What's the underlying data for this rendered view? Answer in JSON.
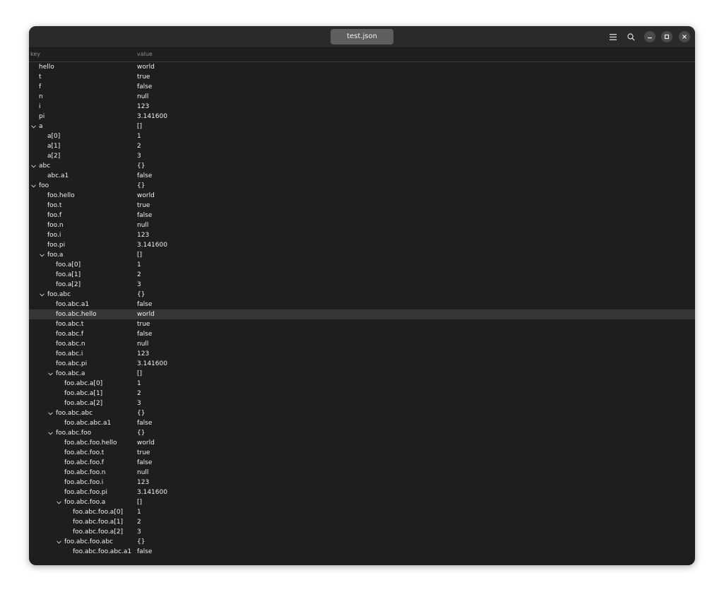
{
  "window": {
    "title": "test.json",
    "icons": [
      "menu-icon",
      "search-icon",
      "minimize-icon",
      "maximize-icon",
      "close-icon"
    ]
  },
  "columns": {
    "key": "key",
    "value": "value"
  },
  "rows": [
    {
      "key": "hello",
      "value": "world",
      "depth": 0,
      "expandable": false
    },
    {
      "key": "t",
      "value": "true",
      "depth": 0,
      "expandable": false
    },
    {
      "key": "f",
      "value": "false",
      "depth": 0,
      "expandable": false
    },
    {
      "key": "n",
      "value": "null",
      "depth": 0,
      "expandable": false
    },
    {
      "key": "i",
      "value": "123",
      "depth": 0,
      "expandable": false
    },
    {
      "key": "pi",
      "value": "3.141600",
      "depth": 0,
      "expandable": false
    },
    {
      "key": "a",
      "value": "[]",
      "depth": 0,
      "expandable": true
    },
    {
      "key": "a[0]",
      "value": "1",
      "depth": 1,
      "expandable": false
    },
    {
      "key": "a[1]",
      "value": "2",
      "depth": 1,
      "expandable": false
    },
    {
      "key": "a[2]",
      "value": "3",
      "depth": 1,
      "expandable": false
    },
    {
      "key": "abc",
      "value": "{}",
      "depth": 0,
      "expandable": true
    },
    {
      "key": "abc.a1",
      "value": "false",
      "depth": 1,
      "expandable": false
    },
    {
      "key": "foo",
      "value": "{}",
      "depth": 0,
      "expandable": true
    },
    {
      "key": "foo.hello",
      "value": "world",
      "depth": 1,
      "expandable": false
    },
    {
      "key": "foo.t",
      "value": "true",
      "depth": 1,
      "expandable": false
    },
    {
      "key": "foo.f",
      "value": "false",
      "depth": 1,
      "expandable": false
    },
    {
      "key": "foo.n",
      "value": "null",
      "depth": 1,
      "expandable": false
    },
    {
      "key": "foo.i",
      "value": "123",
      "depth": 1,
      "expandable": false
    },
    {
      "key": "foo.pi",
      "value": "3.141600",
      "depth": 1,
      "expandable": false
    },
    {
      "key": "foo.a",
      "value": "[]",
      "depth": 1,
      "expandable": true
    },
    {
      "key": "foo.a[0]",
      "value": "1",
      "depth": 2,
      "expandable": false
    },
    {
      "key": "foo.a[1]",
      "value": "2",
      "depth": 2,
      "expandable": false
    },
    {
      "key": "foo.a[2]",
      "value": "3",
      "depth": 2,
      "expandable": false
    },
    {
      "key": "foo.abc",
      "value": "{}",
      "depth": 1,
      "expandable": true
    },
    {
      "key": "foo.abc.a1",
      "value": "false",
      "depth": 2,
      "expandable": false
    },
    {
      "key": "foo.abc.hello",
      "value": "world",
      "depth": 2,
      "expandable": false,
      "selected": true
    },
    {
      "key": "foo.abc.t",
      "value": "true",
      "depth": 2,
      "expandable": false
    },
    {
      "key": "foo.abc.f",
      "value": "false",
      "depth": 2,
      "expandable": false
    },
    {
      "key": "foo.abc.n",
      "value": "null",
      "depth": 2,
      "expandable": false
    },
    {
      "key": "foo.abc.i",
      "value": "123",
      "depth": 2,
      "expandable": false
    },
    {
      "key": "foo.abc.pi",
      "value": "3.141600",
      "depth": 2,
      "expandable": false
    },
    {
      "key": "foo.abc.a",
      "value": "[]",
      "depth": 2,
      "expandable": true
    },
    {
      "key": "foo.abc.a[0]",
      "value": "1",
      "depth": 3,
      "expandable": false
    },
    {
      "key": "foo.abc.a[1]",
      "value": "2",
      "depth": 3,
      "expandable": false
    },
    {
      "key": "foo.abc.a[2]",
      "value": "3",
      "depth": 3,
      "expandable": false
    },
    {
      "key": "foo.abc.abc",
      "value": "{}",
      "depth": 2,
      "expandable": true
    },
    {
      "key": "foo.abc.abc.a1",
      "value": "false",
      "depth": 3,
      "expandable": false
    },
    {
      "key": "foo.abc.foo",
      "value": "{}",
      "depth": 2,
      "expandable": true
    },
    {
      "key": "foo.abc.foo.hello",
      "value": "world",
      "depth": 3,
      "expandable": false
    },
    {
      "key": "foo.abc.foo.t",
      "value": "true",
      "depth": 3,
      "expandable": false
    },
    {
      "key": "foo.abc.foo.f",
      "value": "false",
      "depth": 3,
      "expandable": false
    },
    {
      "key": "foo.abc.foo.n",
      "value": "null",
      "depth": 3,
      "expandable": false
    },
    {
      "key": "foo.abc.foo.i",
      "value": "123",
      "depth": 3,
      "expandable": false
    },
    {
      "key": "foo.abc.foo.pi",
      "value": "3.141600",
      "depth": 3,
      "expandable": false
    },
    {
      "key": "foo.abc.foo.a",
      "value": "[]",
      "depth": 3,
      "expandable": true
    },
    {
      "key": "foo.abc.foo.a[0]",
      "value": "1",
      "depth": 4,
      "expandable": false
    },
    {
      "key": "foo.abc.foo.a[1]",
      "value": "2",
      "depth": 4,
      "expandable": false
    },
    {
      "key": "foo.abc.foo.a[2]",
      "value": "3",
      "depth": 4,
      "expandable": false
    },
    {
      "key": "foo.abc.foo.abc",
      "value": "{}",
      "depth": 3,
      "expandable": true
    },
    {
      "key": "foo.abc.foo.abc.a1",
      "value": "false",
      "depth": 4,
      "expandable": false
    }
  ]
}
